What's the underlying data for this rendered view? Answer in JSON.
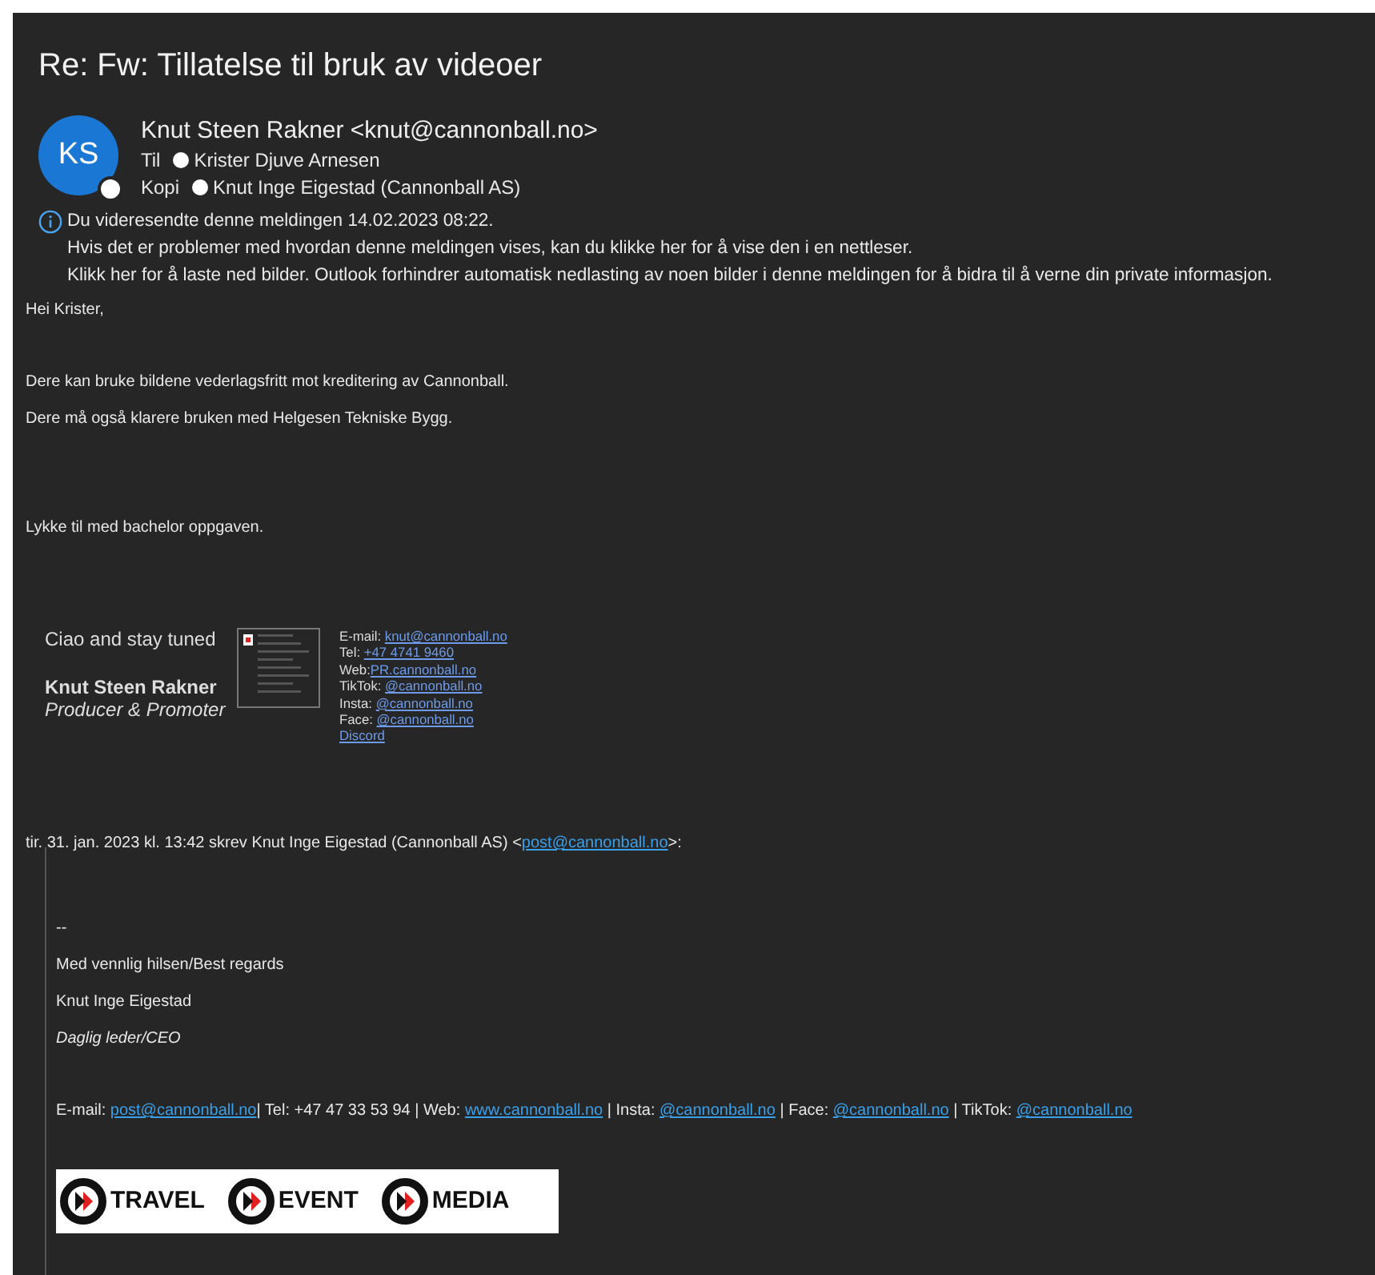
{
  "subject": "Re: Fw: Tillatelse til bruk av videoer",
  "sender": {
    "initials": "KS",
    "name": "Knut Steen Rakner <knut@cannonball.no>"
  },
  "recipients": [
    {
      "label": "Til",
      "name": "Krister Djuve Arnesen"
    },
    {
      "label": "Kopi",
      "name": "Knut Inge Eigestad (Cannonball AS)"
    }
  ],
  "info": [
    "Du videresendte denne meldingen 14.02.2023 08:22.",
    "Hvis det er problemer med hvordan denne meldingen vises, kan du klikke her for å vise den i en nettleser.",
    "Klikk her for å laste ned bilder. Outlook forhindrer automatisk nedlasting av noen bilder i denne meldingen for å bidra til å verne din private informasjon."
  ],
  "body": {
    "greeting": "Hei Krister,",
    "lines": [
      "Dere kan bruke bildene vederlagsfritt mot kreditering av Cannonball.",
      "Dere må også klarere bruken med Helgesen Tekniske Bygg."
    ],
    "closing": "Lykke til med bachelor oppgaven."
  },
  "signature": {
    "tagline": "Ciao and stay tuned",
    "name": "Knut Steen Rakner",
    "role": "Producer & Promoter",
    "contacts": [
      {
        "label": "E-mail: ",
        "link": "knut@cannonball.no"
      },
      {
        "label": "Tel: ",
        "link": "+47 4741 9460"
      },
      {
        "label": "Web:",
        "link": "PR.cannonball.no"
      },
      {
        "label": "TikTok: ",
        "link": "@cannonball.no"
      },
      {
        "label": "Insta: ",
        "link": "@cannonball.no"
      },
      {
        "label": "Face: ",
        "link": "@cannonball.no"
      },
      {
        "link": "Discord"
      }
    ]
  },
  "quote": {
    "header": [
      {
        "kind": "text",
        "text": "tir. 31. jan. 2023 kl. 13:42 skrev Knut Inge Eigestad (Cannonball AS) <"
      },
      {
        "kind": "link",
        "text": "post@cannonball.no"
      },
      {
        "kind": "text",
        "text": ">:"
      }
    ],
    "dashes": "--",
    "regards": "Med vennlig hilsen/Best regards",
    "name": "Knut Inge Eigestad",
    "title": "Daglig leder/CEO",
    "contact": [
      {
        "kind": "text",
        "text": "E-mail: "
      },
      {
        "kind": "link",
        "text": "post@cannonball.no"
      },
      {
        "kind": "text",
        "text": "| Tel: +47 47 33 53 94 | Web: "
      },
      {
        "kind": "link",
        "text": "www.cannonball.no"
      },
      {
        "kind": "text",
        "text": " | Insta: "
      },
      {
        "kind": "link",
        "text": "@cannonball.no"
      },
      {
        "kind": "text",
        "text": " | Face: "
      },
      {
        "kind": "link",
        "text": "@cannonball.no"
      },
      {
        "kind": "text",
        "text": " | TikTok: "
      },
      {
        "kind": "link",
        "text": "@cannonball.no"
      }
    ],
    "logos": [
      "TRAVEL",
      "EVENT",
      "MEDIA"
    ]
  }
}
